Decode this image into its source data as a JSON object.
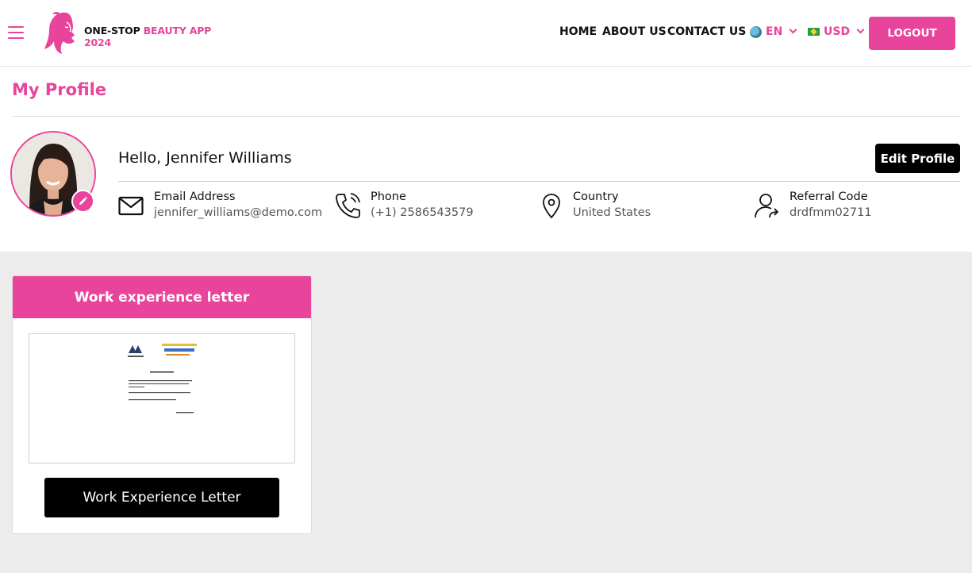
{
  "header": {
    "logo_line1_dark": "ONE-STOP",
    "logo_line1_pink": "BEAUTY APP",
    "logo_line2": "2024",
    "nav": {
      "home": "HOME",
      "about": "ABOUT US",
      "contact": "CONTACT US"
    },
    "language": "EN",
    "currency": "USD",
    "logout_label": "LOGOUT"
  },
  "profile": {
    "title": "My Profile",
    "greeting": "Hello, Jennifer Williams",
    "edit_label": "Edit Profile",
    "email": {
      "label": "Email Address",
      "value": "jennifer_williams@demo.com"
    },
    "phone": {
      "label": "Phone",
      "value": "(+1) 2586543579"
    },
    "country": {
      "label": "Country",
      "value": "United States"
    },
    "referral": {
      "label": "Referral Code",
      "value": "drdfmm02711"
    }
  },
  "card": {
    "title": "Work experience letter",
    "button_label": "Work Experience Letter"
  },
  "colors": {
    "accent": "#e8449b",
    "dark": "#000000",
    "background": "#ececec"
  }
}
